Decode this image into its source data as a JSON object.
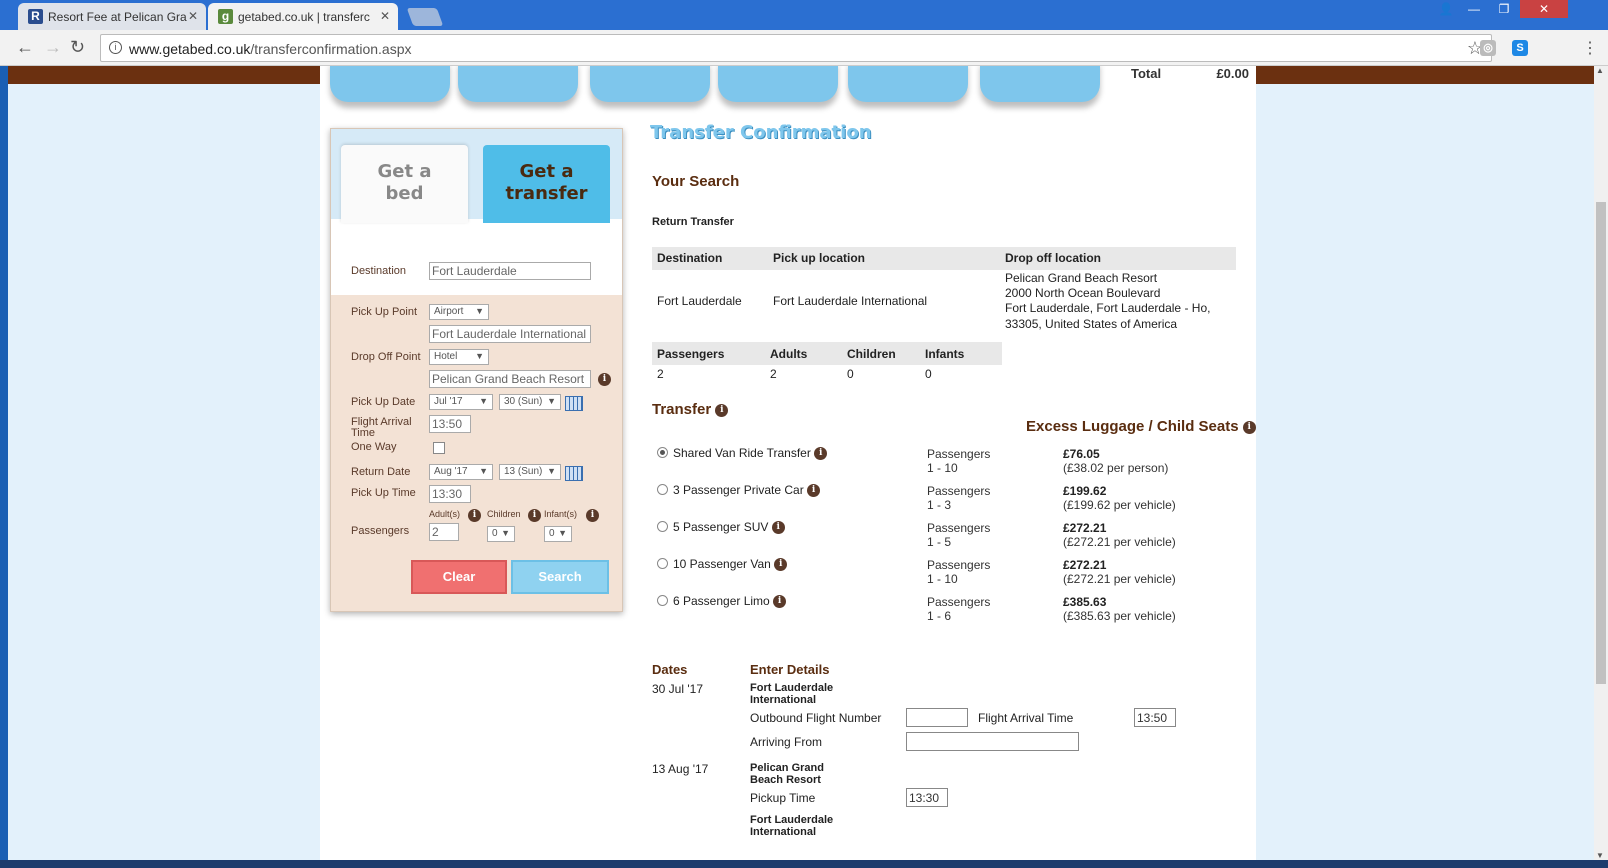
{
  "browser": {
    "tabs": [
      {
        "title": "Resort Fee at Pelican Gra",
        "favicon": "R"
      },
      {
        "title": "getabed.co.uk | transferc",
        "favicon": "g"
      }
    ],
    "url_host": "www.getabed.co.uk",
    "url_path": "/transferconfirmation.aspx"
  },
  "header": {
    "total_label": "Total",
    "total_value": "£0.00"
  },
  "search_panel": {
    "tab_bed": "Get a bed",
    "tab_transfer": "Get a transfer",
    "destination_label": "Destination",
    "destination_value": "Fort Lauderdale",
    "pickup_point_label": "Pick Up Point",
    "pickup_point_type": "Airport",
    "pickup_point_value": "Fort Lauderdale International",
    "dropoff_point_label": "Drop Off Point",
    "dropoff_point_type": "Hotel",
    "dropoff_point_value": "Pelican Grand Beach Resort",
    "pickup_date_label": "Pick Up Date",
    "pickup_month": "Jul '17",
    "pickup_day": "30 (Sun)",
    "flight_arrival_label": "Flight Arrival Time",
    "flight_arrival_value": "13:50",
    "one_way_label": "One Way",
    "return_date_label": "Return Date",
    "return_month": "Aug '17",
    "return_day": "13 (Sun)",
    "pickup_time_label": "Pick Up Time",
    "pickup_time_value": "13:30",
    "passengers_label": "Passengers",
    "adults_label": "Adult(s)",
    "children_label": "Children",
    "infants_label": "Infant(s)",
    "adults_value": "2",
    "children_value": "0",
    "infants_value": "0",
    "clear_label": "Clear",
    "search_label": "Search"
  },
  "confirmation": {
    "title": "Transfer Confirmation",
    "your_search": "Your Search",
    "return_transfer": "Return Transfer",
    "col_destination": "Destination",
    "col_pickup": "Pick up location",
    "col_dropoff": "Drop off location",
    "destination": "Fort Lauderdale",
    "pickup": "Fort Lauderdale International",
    "dropoff_line1": "Pelican Grand Beach Resort",
    "dropoff_line2": "2000 North Ocean Boulevard",
    "dropoff_line3": "Fort Lauderdale, Fort Lauderdale - Ho,",
    "dropoff_line4": "33305, United States of America",
    "col_passengers": "Passengers",
    "col_adults": "Adults",
    "col_children": "Children",
    "col_infants": "Infants",
    "passengers": "2",
    "adults": "2",
    "children": "0",
    "infants": "0",
    "transfer_heading": "Transfer",
    "excess_heading": "Excess Luggage / Child Seats",
    "options": [
      {
        "name": "Shared Van Ride Transfer",
        "pax_label": "Passengers",
        "pax_range": "1 - 10",
        "price": "£76.05",
        "unit": "(£38.02 per person)",
        "selected": true
      },
      {
        "name": "3 Passenger Private Car",
        "pax_label": "Passengers",
        "pax_range": "1 - 3",
        "price": "£199.62",
        "unit": "(£199.62 per vehicle)",
        "selected": false
      },
      {
        "name": "5 Passenger SUV",
        "pax_label": "Passengers",
        "pax_range": "1 - 5",
        "price": "£272.21",
        "unit": "(£272.21 per vehicle)",
        "selected": false
      },
      {
        "name": "10 Passenger Van",
        "pax_label": "Passengers",
        "pax_range": "1 - 10",
        "price": "£272.21",
        "unit": "(£272.21 per vehicle)",
        "selected": false
      },
      {
        "name": "6 Passenger Limo",
        "pax_label": "Passengers",
        "pax_range": "1 - 6",
        "price": "£385.63",
        "unit": "(£385.63 per vehicle)",
        "selected": false
      }
    ],
    "dates_heading": "Dates",
    "enter_details_heading": "Enter Details",
    "outbound_date": "30 Jul '17",
    "outbound_place_line1": "Fort Lauderdale",
    "outbound_place_line2": "International",
    "outbound_flight_label": "Outbound Flight Number",
    "outbound_flight_value": "",
    "flight_arrival_label": "Flight Arrival Time",
    "flight_arrival_value": "13:50",
    "arriving_from_label": "Arriving From",
    "arriving_from_value": "",
    "return_date": "13 Aug '17",
    "return_place_line1": "Pelican Grand",
    "return_place_line2": "Beach Resort",
    "pickup_time_label": "Pickup Time",
    "pickup_time_value": "13:30",
    "return_dest_line1": "Fort Lauderdale",
    "return_dest_line2": "International"
  }
}
